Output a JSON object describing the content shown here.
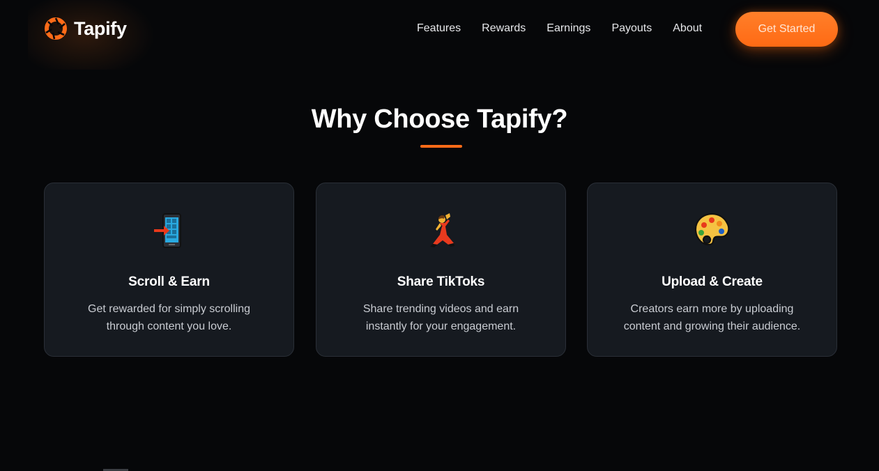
{
  "brand": {
    "name": "Tapify",
    "logo_icon": "aperture-ring-icon",
    "accent_color": "#ff6b18"
  },
  "nav": {
    "items": [
      {
        "label": "Features"
      },
      {
        "label": "Rewards"
      },
      {
        "label": "Earnings"
      },
      {
        "label": "Payouts"
      },
      {
        "label": "About"
      }
    ],
    "cta_label": "Get Started"
  },
  "section": {
    "title": "Why Choose Tapify?"
  },
  "cards": [
    {
      "icon": "mobile-phone-arrow-icon",
      "title": "Scroll & Earn",
      "description": "Get rewarded for simply scrolling through content you love."
    },
    {
      "icon": "dancer-icon",
      "title": "Share TikToks",
      "description": "Share trending videos and earn instantly for your engagement."
    },
    {
      "icon": "artist-palette-icon",
      "title": "Upload & Create",
      "description": "Creators earn more by uploading content and growing their audience."
    }
  ],
  "colors": {
    "background": "#060709",
    "card_background": "#161a20",
    "card_border": "#2a2f37",
    "text_muted": "#c9ccd2"
  }
}
